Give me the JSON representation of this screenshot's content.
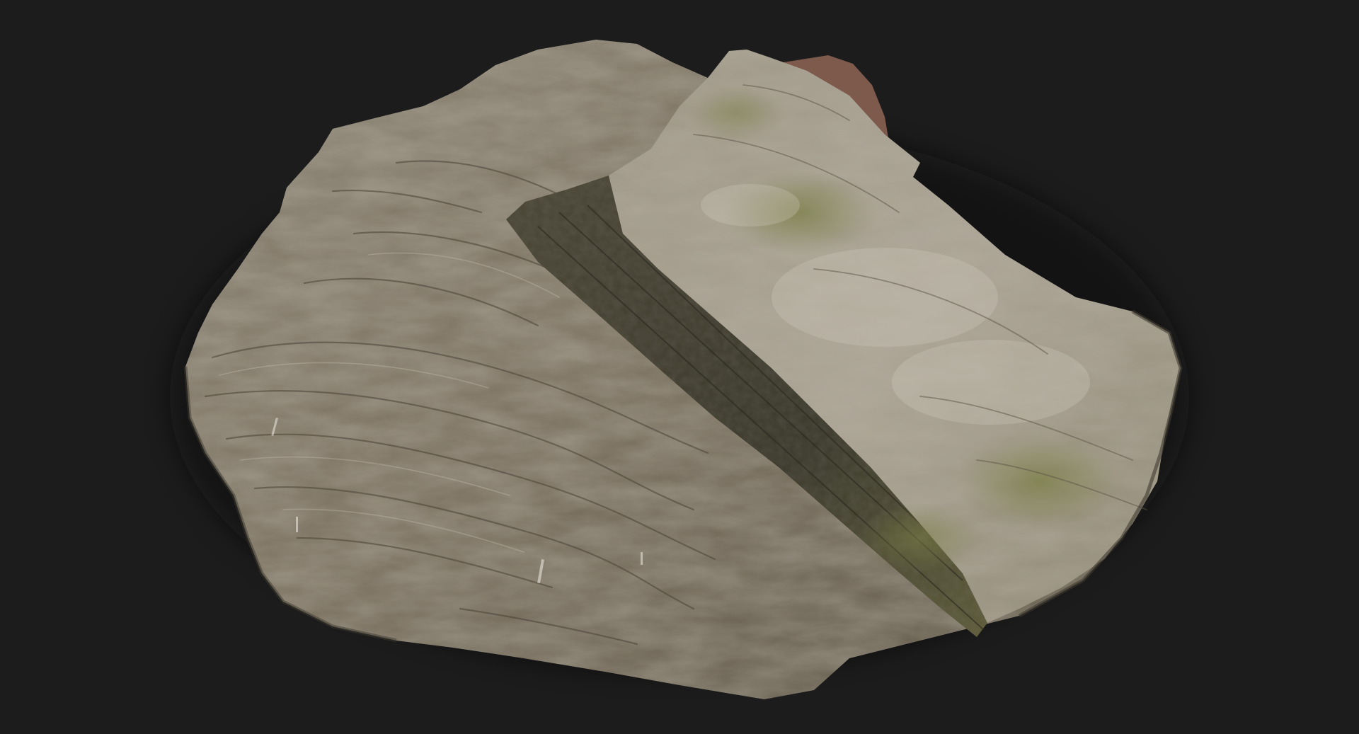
{
  "scene": {
    "background": "#1c1c1c",
    "subject": "rock-icon",
    "palette": {
      "stone_base": "#7d7463",
      "stone_light": "#b2ab9c",
      "stone_dark": "#4f493d",
      "moss": "#6f7340",
      "crevice": "#2e2c22",
      "rust": "#8a5d4c"
    }
  }
}
